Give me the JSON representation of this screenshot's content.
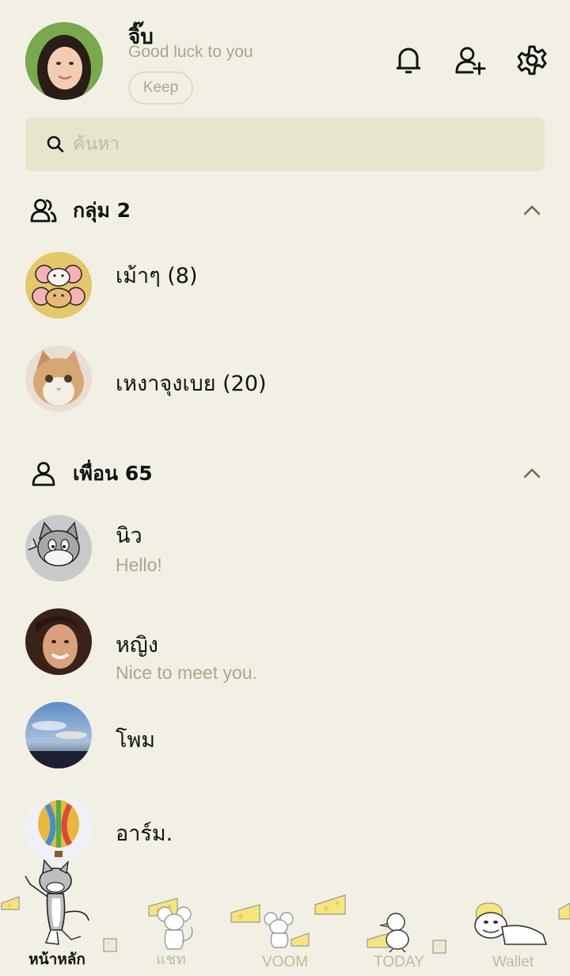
{
  "profile": {
    "name": "จิ๊บ",
    "status": "Good luck to you",
    "keep_label": "Keep"
  },
  "top_icons": [
    "bell-icon",
    "add-friend-icon",
    "settings-icon"
  ],
  "search": {
    "placeholder": "ค้นหา"
  },
  "groups": {
    "title": "กลุ่ม 2",
    "items": [
      {
        "name": "เม้าๆ (8)"
      },
      {
        "name": "เหงาจุงเบย (20)"
      }
    ]
  },
  "friends": {
    "title": "เพื่อน 65",
    "items": [
      {
        "name": "นิว",
        "message": "Hello!"
      },
      {
        "name": "หญิง",
        "message": "Nice to meet you."
      },
      {
        "name": "โพม",
        "message": ""
      },
      {
        "name": "อาร์ม.",
        "message": ""
      }
    ]
  },
  "nav": {
    "items": [
      {
        "label": "หน้าหลัก",
        "active": true
      },
      {
        "label": "แชท",
        "active": false
      },
      {
        "label": "VOOM",
        "active": false
      },
      {
        "label": "TODAY",
        "active": false
      },
      {
        "label": "Wallet",
        "active": false
      }
    ]
  },
  "colors": {
    "background": "#f2f0e4",
    "search_bg": "#e8e5ce",
    "muted_text": "#a9a78a",
    "cheese": "#f7e57a"
  }
}
